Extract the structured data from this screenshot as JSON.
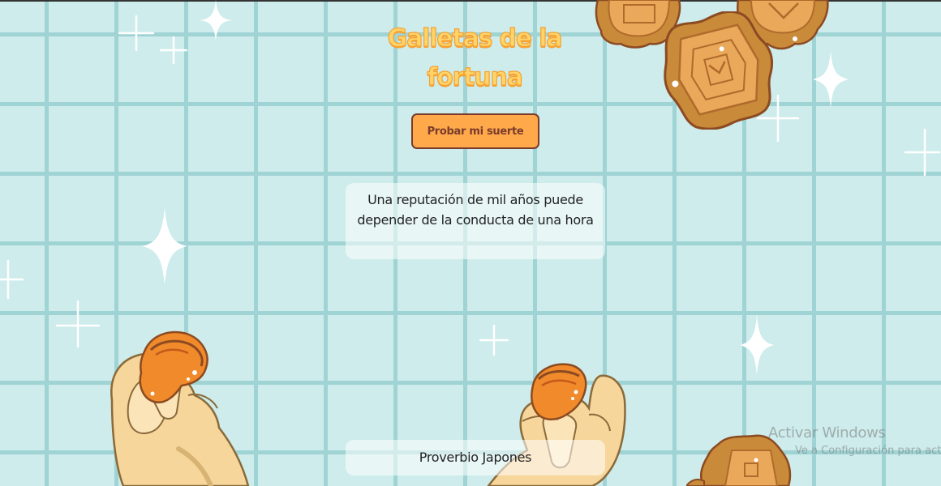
{
  "page": {
    "title": "Galletas de la fortuna",
    "button_label": "Probar mi suerte",
    "quote": "Una reputación de mil años puede depender de la conducta de una hora",
    "author": "Proverbio Japones"
  },
  "os_watermark": {
    "title": "Activar Windows",
    "subtitle": "Ve a Configuración para activar Windows."
  },
  "colors": {
    "background": "#cdeceb",
    "grid_line": "#9fd3d4",
    "title_fill": "#ffd46a",
    "button_fill": "#ffa94a",
    "button_border": "#7a3b2c",
    "card_fill": "#ffffff8c"
  },
  "icons": [
    "mooncake-icon",
    "fortune-cookie-icon",
    "hand-icon",
    "sparkle-icon"
  ]
}
